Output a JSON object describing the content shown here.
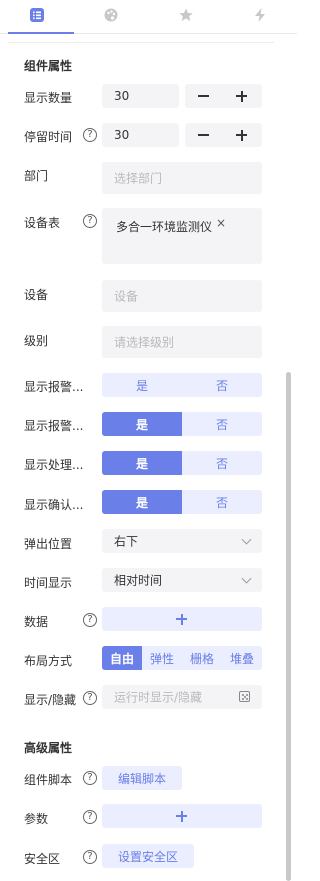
{
  "tabs": [
    {
      "icon": "list-icon",
      "active": true
    },
    {
      "icon": "palette-icon",
      "active": false
    },
    {
      "icon": "star-icon",
      "active": false
    },
    {
      "icon": "lightning-icon",
      "active": false
    }
  ],
  "sections": {
    "component": "组件属性",
    "advanced": "高级属性"
  },
  "fields": {
    "display_count": {
      "label": "显示数量",
      "value": "30"
    },
    "dwell_time": {
      "label": "停留时间",
      "value": "30"
    },
    "department": {
      "label": "部门",
      "placeholder": "选择部门"
    },
    "device_table": {
      "label": "设备表",
      "tag": "多合一环境监测仪",
      "remove": "×"
    },
    "device": {
      "label": "设备",
      "placeholder": "设备"
    },
    "level": {
      "label": "级别",
      "placeholder": "请选择级别"
    },
    "alarm1": {
      "label": "显示报警...",
      "yes": "是",
      "no": "否",
      "selected": "none"
    },
    "alarm2": {
      "label": "显示报警...",
      "yes": "是",
      "no": "否",
      "selected": "yes"
    },
    "handling": {
      "label": "显示处理...",
      "yes": "是",
      "no": "否",
      "selected": "yes"
    },
    "confirm": {
      "label": "显示确认...",
      "yes": "是",
      "no": "否",
      "selected": "yes"
    },
    "popup_position": {
      "label": "弹出位置",
      "value": "右下"
    },
    "time_display": {
      "label": "时间显示",
      "value": "相对时间"
    },
    "data": {
      "label": "数据",
      "add": "+"
    },
    "layout": {
      "label": "布局方式",
      "options": [
        "自由",
        "弹性",
        "栅格",
        "堆叠"
      ],
      "selected": "自由"
    },
    "visibility": {
      "label": "显示/隐藏",
      "placeholder": "运行时显示/隐藏"
    },
    "script": {
      "label": "组件脚本",
      "button": "编辑脚本"
    },
    "params": {
      "label": "参数",
      "add": "+"
    },
    "security": {
      "label": "安全区",
      "button": "设置安全区"
    }
  },
  "help_glyph": "?",
  "colors": {
    "accent": "#6b7fe8",
    "accent_soft": "#eaeefe",
    "field_bg": "#f4f4f6",
    "placeholder": "#b9b9bf"
  }
}
